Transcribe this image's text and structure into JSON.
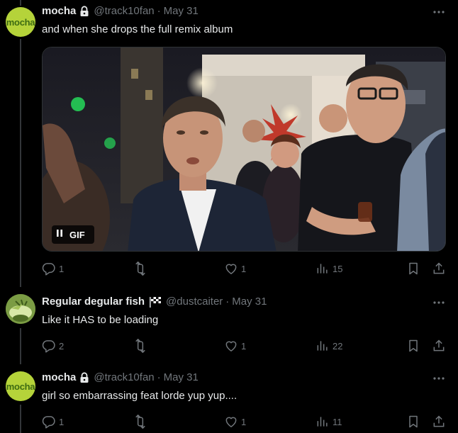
{
  "colors": {
    "background": "#000000",
    "text": "#e7e9ea",
    "muted": "#71767b",
    "thread_line": "#333639",
    "mocha_avatar": "#b5d33a"
  },
  "posts": [
    {
      "avatar_text": "mocha",
      "avatar_icon": "mocha-avatar",
      "name": "mocha",
      "locked": true,
      "handle": "@track10fan",
      "date": "May 31",
      "text": "and when she drops the full remix album",
      "media": {
        "type": "gif",
        "label": "GIF",
        "control": "pause-icon"
      },
      "replies": "1",
      "reposts": "",
      "likes": "1",
      "views": "15"
    },
    {
      "avatar_icon": "fish-avatar",
      "name": "Regular degular fish",
      "name_emoji": "checkered-flag-icon",
      "handle": "@dustcaiter",
      "date": "May 31",
      "text": "Like it HAS to be loading",
      "replies": "2",
      "reposts": "",
      "likes": "1",
      "views": "22"
    },
    {
      "avatar_text": "mocha",
      "avatar_icon": "mocha-avatar",
      "name": "mocha",
      "locked": true,
      "handle": "@track10fan",
      "date": "May 31",
      "text": "girl so embarrassing feat lorde yup yup....",
      "replies": "1",
      "reposts": "",
      "likes": "1",
      "views": "11"
    }
  ],
  "middle_dot": "·"
}
